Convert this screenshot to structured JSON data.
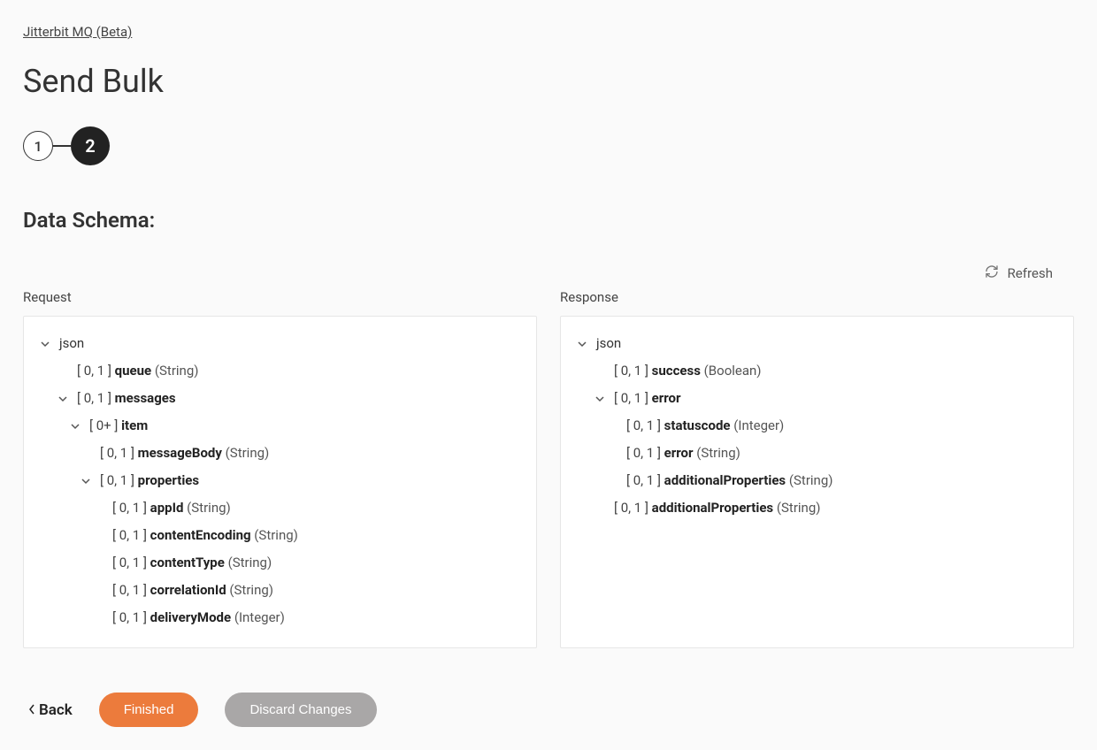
{
  "breadcrumb": {
    "label": "Jitterbit MQ (Beta)"
  },
  "page": {
    "title": "Send Bulk"
  },
  "stepper": {
    "step1": "1",
    "step2": "2"
  },
  "section": {
    "heading": "Data Schema:"
  },
  "refresh": {
    "label": "Refresh"
  },
  "columns": {
    "request_label": "Request",
    "response_label": "Response"
  },
  "request_tree": {
    "root": "json",
    "queue": {
      "card": "[ 0, 1 ]",
      "name": "queue",
      "type": "(String)"
    },
    "messages": {
      "card": "[ 0, 1 ]",
      "name": "messages"
    },
    "item": {
      "card": "[ 0+ ]",
      "name": "item"
    },
    "messageBody": {
      "card": "[ 0, 1 ]",
      "name": "messageBody",
      "type": "(String)"
    },
    "properties": {
      "card": "[ 0, 1 ]",
      "name": "properties"
    },
    "appId": {
      "card": "[ 0, 1 ]",
      "name": "appId",
      "type": "(String)"
    },
    "contentEncoding": {
      "card": "[ 0, 1 ]",
      "name": "contentEncoding",
      "type": "(String)"
    },
    "contentType": {
      "card": "[ 0, 1 ]",
      "name": "contentType",
      "type": "(String)"
    },
    "correlationId": {
      "card": "[ 0, 1 ]",
      "name": "correlationId",
      "type": "(String)"
    },
    "deliveryMode": {
      "card": "[ 0, 1 ]",
      "name": "deliveryMode",
      "type": "(Integer)"
    }
  },
  "response_tree": {
    "root": "json",
    "success": {
      "card": "[ 0, 1 ]",
      "name": "success",
      "type": "(Boolean)"
    },
    "error": {
      "card": "[ 0, 1 ]",
      "name": "error"
    },
    "statuscode": {
      "card": "[ 0, 1 ]",
      "name": "statuscode",
      "type": "(Integer)"
    },
    "error_inner": {
      "card": "[ 0, 1 ]",
      "name": "error",
      "type": "(String)"
    },
    "additionalProperties_inner": {
      "card": "[ 0, 1 ]",
      "name": "additionalProperties",
      "type": "(String)"
    },
    "additionalProperties": {
      "card": "[ 0, 1 ]",
      "name": "additionalProperties",
      "type": "(String)"
    }
  },
  "footer": {
    "back": "Back",
    "finished": "Finished",
    "discard": "Discard Changes"
  }
}
